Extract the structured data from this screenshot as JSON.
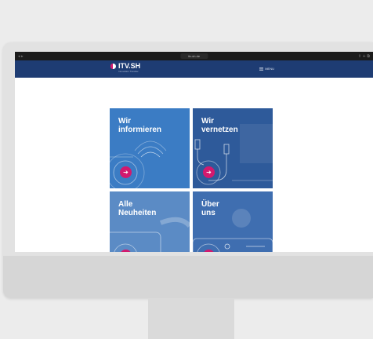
{
  "browser": {
    "controls": "◂ ▸",
    "url": "itv-sh.de",
    "right_icons": "⇪ + ⧉"
  },
  "header": {
    "logo_text": "ITV.SH",
    "logo_subtitle": "Innovation Transfer",
    "menu_label": "MENU",
    "menu_icon": "hamburger-icon"
  },
  "tiles": [
    {
      "id": "informieren",
      "line1": "Wir",
      "line2": "informieren",
      "color": "#3b7cc4",
      "arrow_icon": "arrow-right-icon"
    },
    {
      "id": "vernetzen",
      "line1": "Wir",
      "line2": "vernetzen",
      "color": "#2e5a9a",
      "arrow_icon": "arrow-right-icon"
    },
    {
      "id": "neuheiten",
      "line1": "Alle",
      "line2": "Neuheiten",
      "color": "#5b8bc5",
      "arrow_icon": "arrow-right-icon"
    },
    {
      "id": "ueber-uns",
      "line1": "Über",
      "line2": "uns",
      "color": "#3f6eb0",
      "arrow_icon": "arrow-right-icon"
    }
  ],
  "arrow_glyph": "➔",
  "colors": {
    "header": "#1e3c73",
    "accent": "#d3196e"
  }
}
